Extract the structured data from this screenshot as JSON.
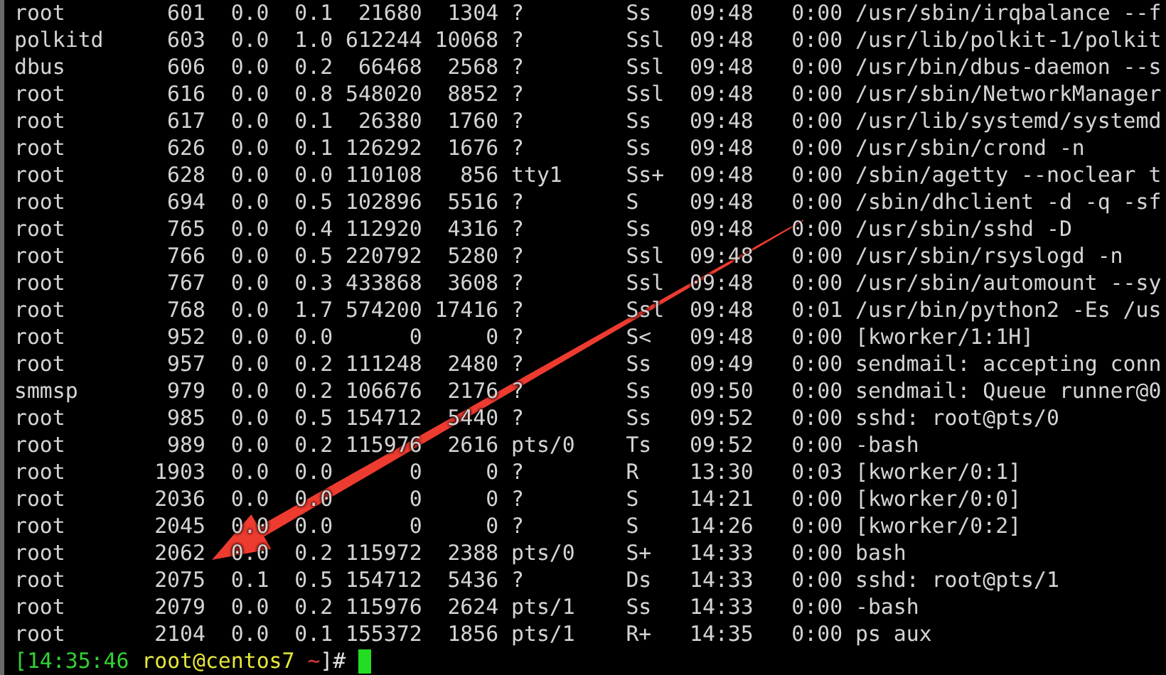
{
  "terminal": {
    "rows": [
      [
        "root",
        "601",
        "0.0",
        "0.1",
        "21680",
        "1304",
        "?",
        "Ss",
        "09:48",
        "0:00",
        "/usr/sbin/irqbalance --f"
      ],
      [
        "polkitd",
        "603",
        "0.0",
        "1.0",
        "612244",
        "10068",
        "?",
        "Ssl",
        "09:48",
        "0:00",
        "/usr/lib/polkit-1/polkit"
      ],
      [
        "dbus",
        "606",
        "0.0",
        "0.2",
        "66468",
        "2568",
        "?",
        "Ssl",
        "09:48",
        "0:00",
        "/usr/bin/dbus-daemon --s"
      ],
      [
        "root",
        "616",
        "0.0",
        "0.8",
        "548020",
        "8852",
        "?",
        "Ssl",
        "09:48",
        "0:00",
        "/usr/sbin/NetworkManager"
      ],
      [
        "root",
        "617",
        "0.0",
        "0.1",
        "26380",
        "1760",
        "?",
        "Ss",
        "09:48",
        "0:00",
        "/usr/lib/systemd/systemd"
      ],
      [
        "root",
        "626",
        "0.0",
        "0.1",
        "126292",
        "1676",
        "?",
        "Ss",
        "09:48",
        "0:00",
        "/usr/sbin/crond -n"
      ],
      [
        "root",
        "628",
        "0.0",
        "0.0",
        "110108",
        "856",
        "tty1",
        "Ss+",
        "09:48",
        "0:00",
        "/sbin/agetty --noclear t"
      ],
      [
        "root",
        "694",
        "0.0",
        "0.5",
        "102896",
        "5516",
        "?",
        "S",
        "09:48",
        "0:00",
        "/sbin/dhclient -d -q -sf"
      ],
      [
        "root",
        "765",
        "0.0",
        "0.4",
        "112920",
        "4316",
        "?",
        "Ss",
        "09:48",
        "0:00",
        "/usr/sbin/sshd -D"
      ],
      [
        "root",
        "766",
        "0.0",
        "0.5",
        "220792",
        "5280",
        "?",
        "Ssl",
        "09:48",
        "0:00",
        "/usr/sbin/rsyslogd -n"
      ],
      [
        "root",
        "767",
        "0.0",
        "0.3",
        "433868",
        "3608",
        "?",
        "Ssl",
        "09:48",
        "0:00",
        "/usr/sbin/automount --sy"
      ],
      [
        "root",
        "768",
        "0.0",
        "1.7",
        "574200",
        "17416",
        "?",
        "Ssl",
        "09:48",
        "0:01",
        "/usr/bin/python2 -Es /us"
      ],
      [
        "root",
        "952",
        "0.0",
        "0.0",
        "0",
        "0",
        "?",
        "S<",
        "09:48",
        "0:00",
        "[kworker/1:1H]"
      ],
      [
        "root",
        "957",
        "0.0",
        "0.2",
        "111248",
        "2480",
        "?",
        "Ss",
        "09:49",
        "0:00",
        "sendmail: accepting conn"
      ],
      [
        "smmsp",
        "979",
        "0.0",
        "0.2",
        "106676",
        "2176",
        "?",
        "Ss",
        "09:50",
        "0:00",
        "sendmail: Queue runner@0"
      ],
      [
        "root",
        "985",
        "0.0",
        "0.5",
        "154712",
        "5440",
        "?",
        "Ss",
        "09:52",
        "0:00",
        "sshd: root@pts/0"
      ],
      [
        "root",
        "989",
        "0.0",
        "0.2",
        "115976",
        "2616",
        "pts/0",
        "Ts",
        "09:52",
        "0:00",
        "-bash"
      ],
      [
        "root",
        "1903",
        "0.0",
        "0.0",
        "0",
        "0",
        "?",
        "R",
        "13:30",
        "0:03",
        "[kworker/0:1]"
      ],
      [
        "root",
        "2036",
        "0.0",
        "0.0",
        "0",
        "0",
        "?",
        "S",
        "14:21",
        "0:00",
        "[kworker/0:0]"
      ],
      [
        "root",
        "2045",
        "0.0",
        "0.0",
        "0",
        "0",
        "?",
        "S",
        "14:26",
        "0:00",
        "[kworker/0:2]"
      ],
      [
        "root",
        "2062",
        "0.0",
        "0.2",
        "115972",
        "2388",
        "pts/0",
        "S+",
        "14:33",
        "0:00",
        "bash"
      ],
      [
        "root",
        "2075",
        "0.1",
        "0.5",
        "154712",
        "5436",
        "?",
        "Ds",
        "14:33",
        "0:00",
        "sshd: root@pts/1"
      ],
      [
        "root",
        "2079",
        "0.0",
        "0.2",
        "115976",
        "2624",
        "pts/1",
        "Ss",
        "14:33",
        "0:00",
        "-bash"
      ],
      [
        "root",
        "2104",
        "0.0",
        "0.1",
        "155372",
        "1856",
        "pts/1",
        "R+",
        "14:35",
        "0:00",
        "ps aux"
      ]
    ],
    "prompt": {
      "time": "[14:35:46",
      "user_host": "root@centos7",
      "path": "~",
      "suffix": "]#"
    }
  }
}
